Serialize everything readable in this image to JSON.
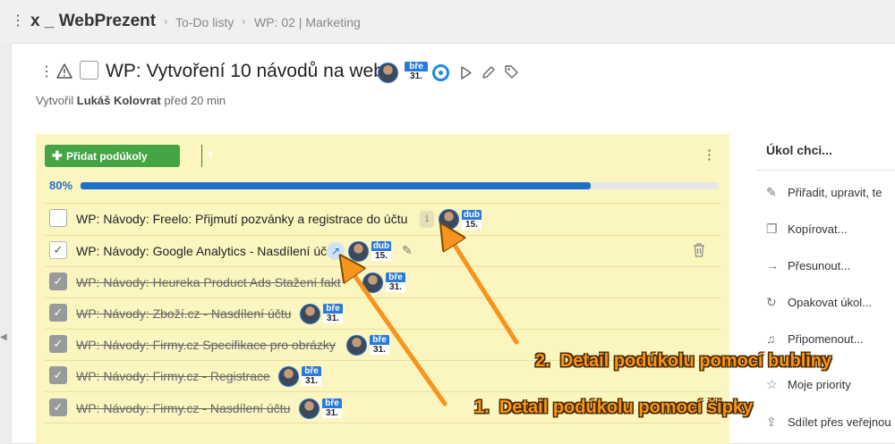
{
  "header": {
    "project": "x _ WebPrezent",
    "breadcrumbs": [
      "To-Do listy",
      "WP: 02 | Marketing"
    ]
  },
  "task": {
    "title": "WP: Vytvoření 10 návodů na web",
    "due_month": "bře",
    "due_day": "31.",
    "created_prefix": "Vytvořil",
    "created_by": "Lukáš Kolovrat",
    "created_when": "před 20 min"
  },
  "subtasks_panel": {
    "add_button": "Přidat podúkoly",
    "progress_label": "80%",
    "progress": 0.8,
    "items": [
      {
        "text": "WP: Návody: Freelo: Přijmutí pozvánky a registrace do účtu",
        "done": false,
        "bubble": "1",
        "due_month": "dub",
        "due_day": "15."
      },
      {
        "text": "WP: Návody: Google Analytics - Nasdílení úč",
        "done": false,
        "due_month": "dub",
        "due_day": "15."
      },
      {
        "text": "WP: Návody: Heureka Product Ads Stažení fakt",
        "done": true,
        "due_month": "bře",
        "due_day": "31."
      },
      {
        "text": "WP: Návody: Zboží.cz - Nasdílení účtu",
        "done": true,
        "due_month": "bře",
        "due_day": "31."
      },
      {
        "text": "WP: Návody: Firmy.cz Specifikace pro obrázky",
        "done": true,
        "due_month": "bře",
        "due_day": "31."
      },
      {
        "text": "WP: Návody: Firmy.cz - Registrace",
        "done": true,
        "due_month": "bře",
        "due_day": "31."
      },
      {
        "text": "WP: Návody: Firmy.cz - Nasdílení účtu",
        "done": true,
        "due_month": "bře",
        "due_day": "31."
      }
    ]
  },
  "sidebar": {
    "title": "Úkol chci...",
    "items": [
      {
        "label": "Přiřadit, upravit, te",
        "icon": "pencil-icon"
      },
      {
        "label": "Kopírovat...",
        "icon": "copy-icon"
      },
      {
        "label": "Přesunout...",
        "icon": "arrow-right-icon"
      },
      {
        "label": "Opakovat úkol...",
        "icon": "repeat-icon"
      },
      {
        "label": "Připomenout...",
        "icon": "bell-icon"
      },
      {
        "label": "Moje priority",
        "icon": "star-icon"
      },
      {
        "label": "Sdílet přes veřejnou",
        "icon": "share-icon"
      }
    ]
  },
  "annotations": {
    "a1_num": "1.",
    "a1_text": "Detail podúkolu pomocí šipky",
    "a2_num": "2.",
    "a2_text": "Detail podúkolu pomocí bubliny"
  },
  "colors": {
    "accent": "#1e6fc8",
    "add_button": "#45a545",
    "panel": "#fbf5bf",
    "annotation": "#f7941d"
  }
}
